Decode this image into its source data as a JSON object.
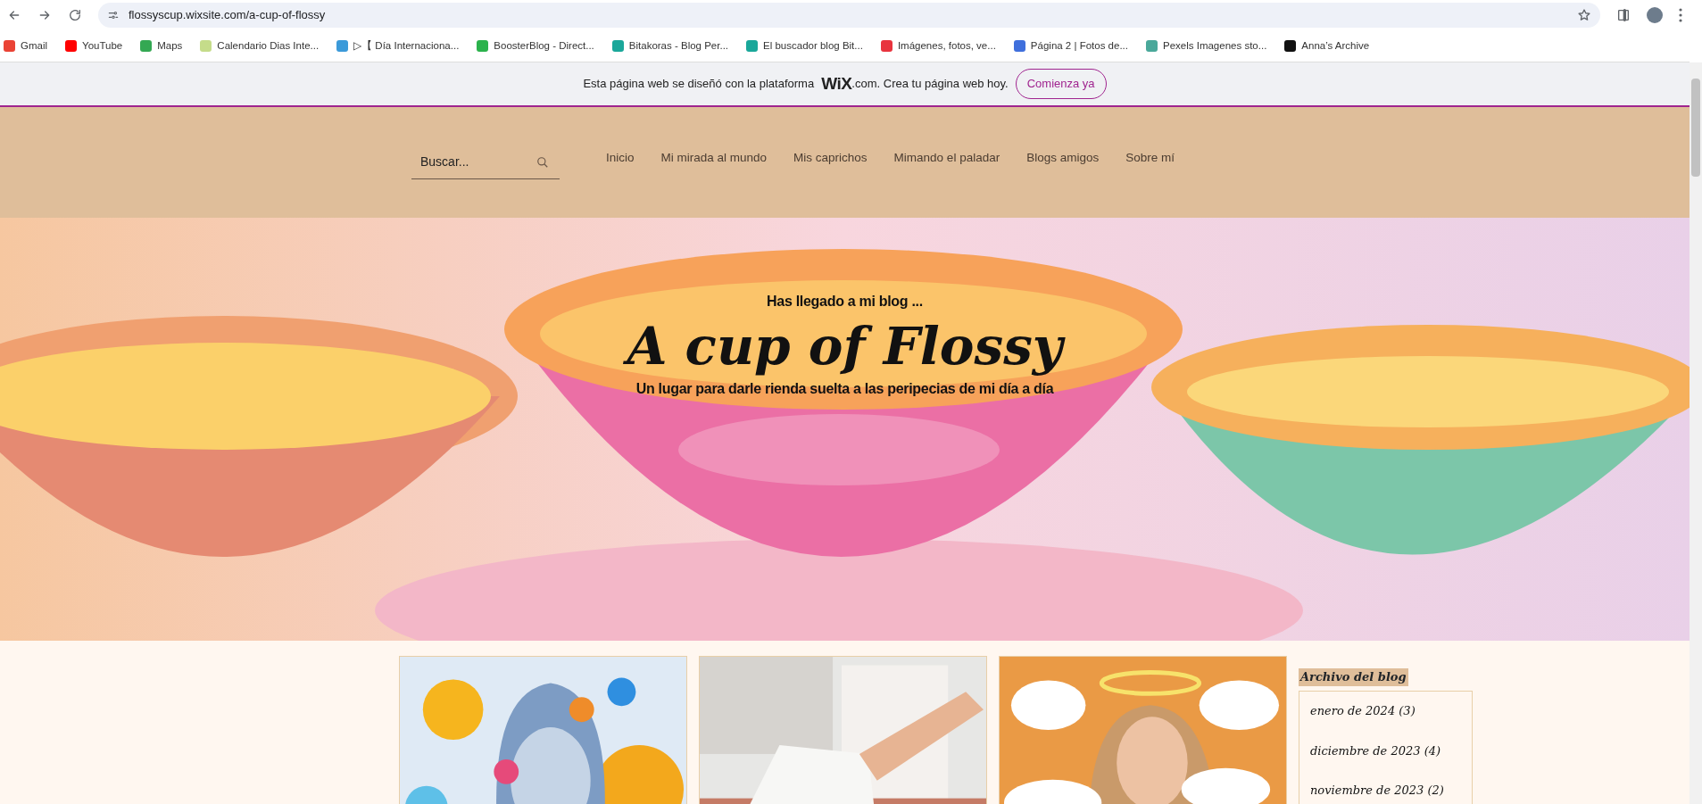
{
  "browser": {
    "url": "flossyscup.wixsite.com/a-cup-of-flossy",
    "bookmarks": [
      {
        "label": "Gmail",
        "color": "#ea4335"
      },
      {
        "label": "YouTube",
        "color": "#ff0000"
      },
      {
        "label": "Maps",
        "color": "#34a853"
      },
      {
        "label": "Calendario Dias Inte...",
        "color": "#c5dc8a"
      },
      {
        "label": "▷【 Día Internaciona...",
        "color": "#3b9ad9"
      },
      {
        "label": "BoosterBlog - Direct...",
        "color": "#2bb24c"
      },
      {
        "label": "Bitakoras - Blog Per...",
        "color": "#1aa79a"
      },
      {
        "label": "El buscador blog Bit...",
        "color": "#1aa79a"
      },
      {
        "label": "Imágenes, fotos, ve...",
        "color": "#e8343e"
      },
      {
        "label": "Página 2 | Fotos de...",
        "color": "#3f6fdc"
      },
      {
        "label": "Pexels Imagenes sto...",
        "color": "#4aa89a"
      },
      {
        "label": "Anna’s Archive",
        "color": "#111111"
      }
    ]
  },
  "wix_banner": {
    "text_before": "Esta página web se diseñó con la plataforma",
    "logo": "WiX",
    "text_after": ".com. Crea tu página web hoy.",
    "button": "Comienza ya"
  },
  "nav": {
    "search": {
      "placeholder": "Buscar..."
    },
    "items": [
      "Inicio",
      "Mi mirada al mundo",
      "Mis caprichos",
      "Mimando el paladar",
      "Blogs amigos",
      "Sobre mí"
    ]
  },
  "hero": {
    "kicker": "Has llegado a mi blog ...",
    "title": "A cup of Flossy",
    "subtitle": "Un lugar para darle rienda suelta a las peripecias de mi día a día"
  },
  "archive": {
    "title": "Archivo del blog",
    "entries": [
      "enero de 2024 (3)",
      "diciembre de 2023 (4)",
      "noviembre de 2023 (2)"
    ]
  }
}
